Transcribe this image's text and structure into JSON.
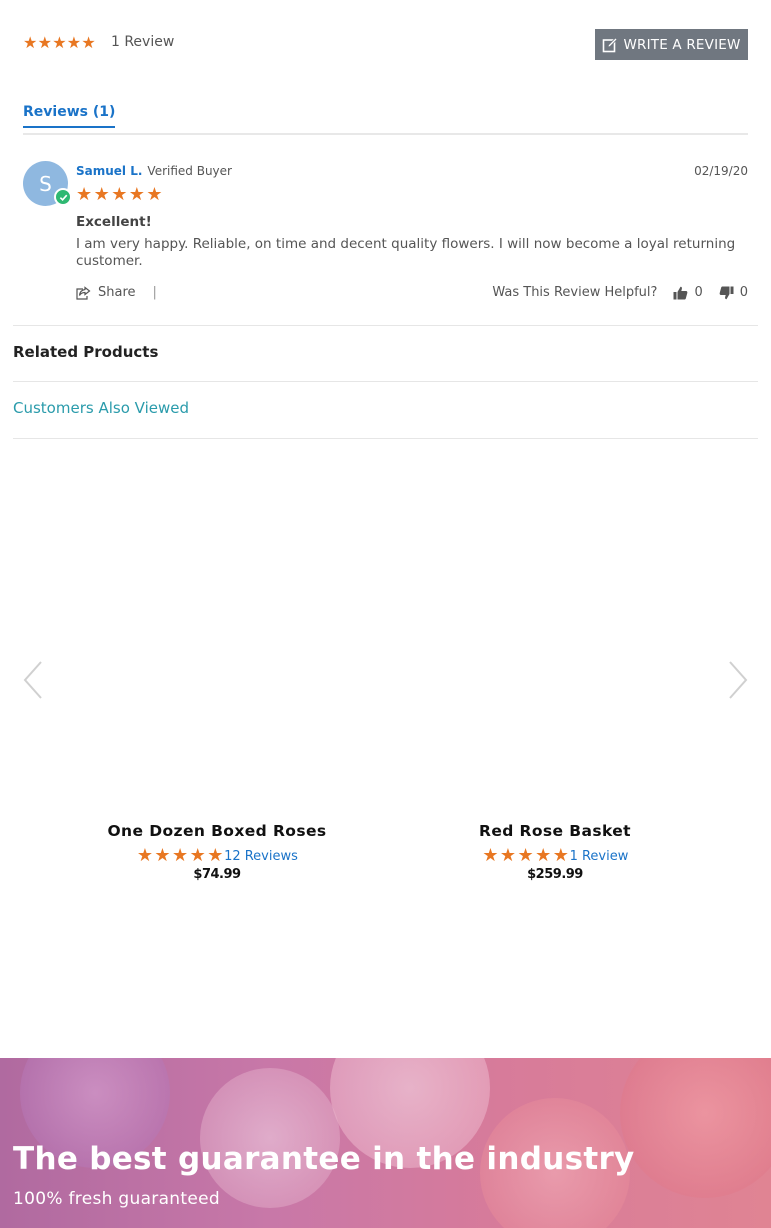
{
  "summary": {
    "rating": 5,
    "count_label": "1 Review",
    "write_review_label": "WRITE A REVIEW"
  },
  "tabs": [
    {
      "label": "Reviews (1)",
      "active": true
    }
  ],
  "review": {
    "avatar_initial": "S",
    "name": "Samuel L.",
    "badge": "Verified Buyer",
    "date": "02/19/20",
    "rating": 5,
    "title": "Excellent!",
    "body": "I am very happy. Reliable, on time and decent quality flowers. I will now become a loyal returning customer.",
    "share_label": "Share",
    "separator": "|",
    "helpful_label": "Was This Review Helpful?",
    "up_votes": "0",
    "down_votes": "0"
  },
  "related": {
    "title": "Related Products",
    "tab": "Customers Also Viewed"
  },
  "products": [
    {
      "name": "One Dozen Boxed Roses",
      "rating": 5,
      "reviews": "12 Reviews",
      "price": "$74.99"
    },
    {
      "name": "Red Rose Basket",
      "rating": 5,
      "reviews": "1 Review",
      "price": "$259.99"
    }
  ],
  "banner": {
    "title": "The best guarantee in the industry",
    "subtitle": "100% fresh guaranteed"
  },
  "colors": {
    "star": "#e87722",
    "accent": "#1a73c8",
    "teal": "#2a9bab",
    "button": "#707780",
    "verified": "#2eb872"
  },
  "icons": [
    "star-icon",
    "edit-icon",
    "check-icon",
    "share-icon",
    "thumbs-up-icon",
    "thumbs-down-icon",
    "chevron-left-icon",
    "chevron-right-icon"
  ]
}
